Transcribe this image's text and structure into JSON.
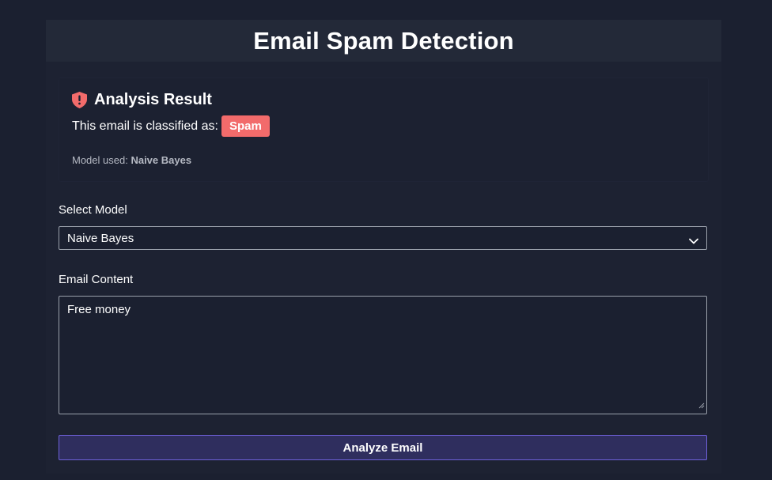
{
  "header": {
    "title": "Email Spam Detection"
  },
  "result": {
    "icon": "shield-alert-icon",
    "title": "Analysis Result",
    "classified_label": "This email is classified as:",
    "classification": "Spam",
    "model_used_label": "Model used:",
    "model_used_value": "Naive Bayes"
  },
  "form": {
    "model_label": "Select Model",
    "model_selected": "Naive Bayes",
    "content_label": "Email Content",
    "content_value": "Free money",
    "submit_label": "Analyze Email"
  },
  "colors": {
    "background": "#1b2030",
    "header": "#232938",
    "spam_badge": "#f26b6b",
    "button_bg": "#2f2e5e",
    "button_border": "#6e61d9"
  }
}
